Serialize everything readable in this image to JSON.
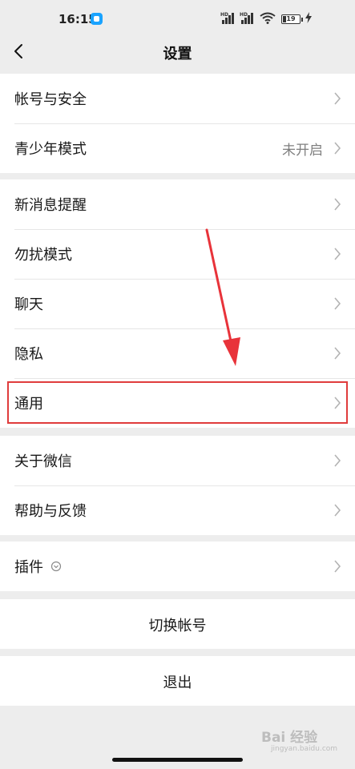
{
  "status_bar": {
    "time": "16:15",
    "network_1": "HD",
    "network_2": "HD",
    "battery_level": "19",
    "battery_fraction": 0.19,
    "icons": [
      "app-notification-icon",
      "signal-icon",
      "signal-icon",
      "wifi-icon",
      "battery-icon",
      "charging-icon"
    ]
  },
  "header": {
    "title": "设置",
    "back_icon": "chevron-left-icon"
  },
  "groups": [
    {
      "items": [
        {
          "label": "帐号与安全",
          "value": ""
        },
        {
          "label": "青少年模式",
          "value": "未开启"
        }
      ]
    },
    {
      "items": [
        {
          "label": "新消息提醒",
          "value": ""
        },
        {
          "label": "勿扰模式",
          "value": ""
        },
        {
          "label": "聊天",
          "value": ""
        },
        {
          "label": "隐私",
          "value": ""
        },
        {
          "label": "通用",
          "value": "",
          "highlighted": true
        }
      ]
    },
    {
      "items": [
        {
          "label": "关于微信",
          "value": ""
        },
        {
          "label": "帮助与反馈",
          "value": ""
        }
      ]
    },
    {
      "items": [
        {
          "label": "插件",
          "value": "",
          "icon": "plugin-icon"
        }
      ]
    }
  ],
  "actions": {
    "switch_account": "切换帐号",
    "logout": "退出"
  },
  "annotation": {
    "highlight_color": "#e03c3c",
    "arrow_color": "#e8333a"
  },
  "watermark": {
    "text": "Bai 经验",
    "sub": "jingyan.baidu.com"
  }
}
